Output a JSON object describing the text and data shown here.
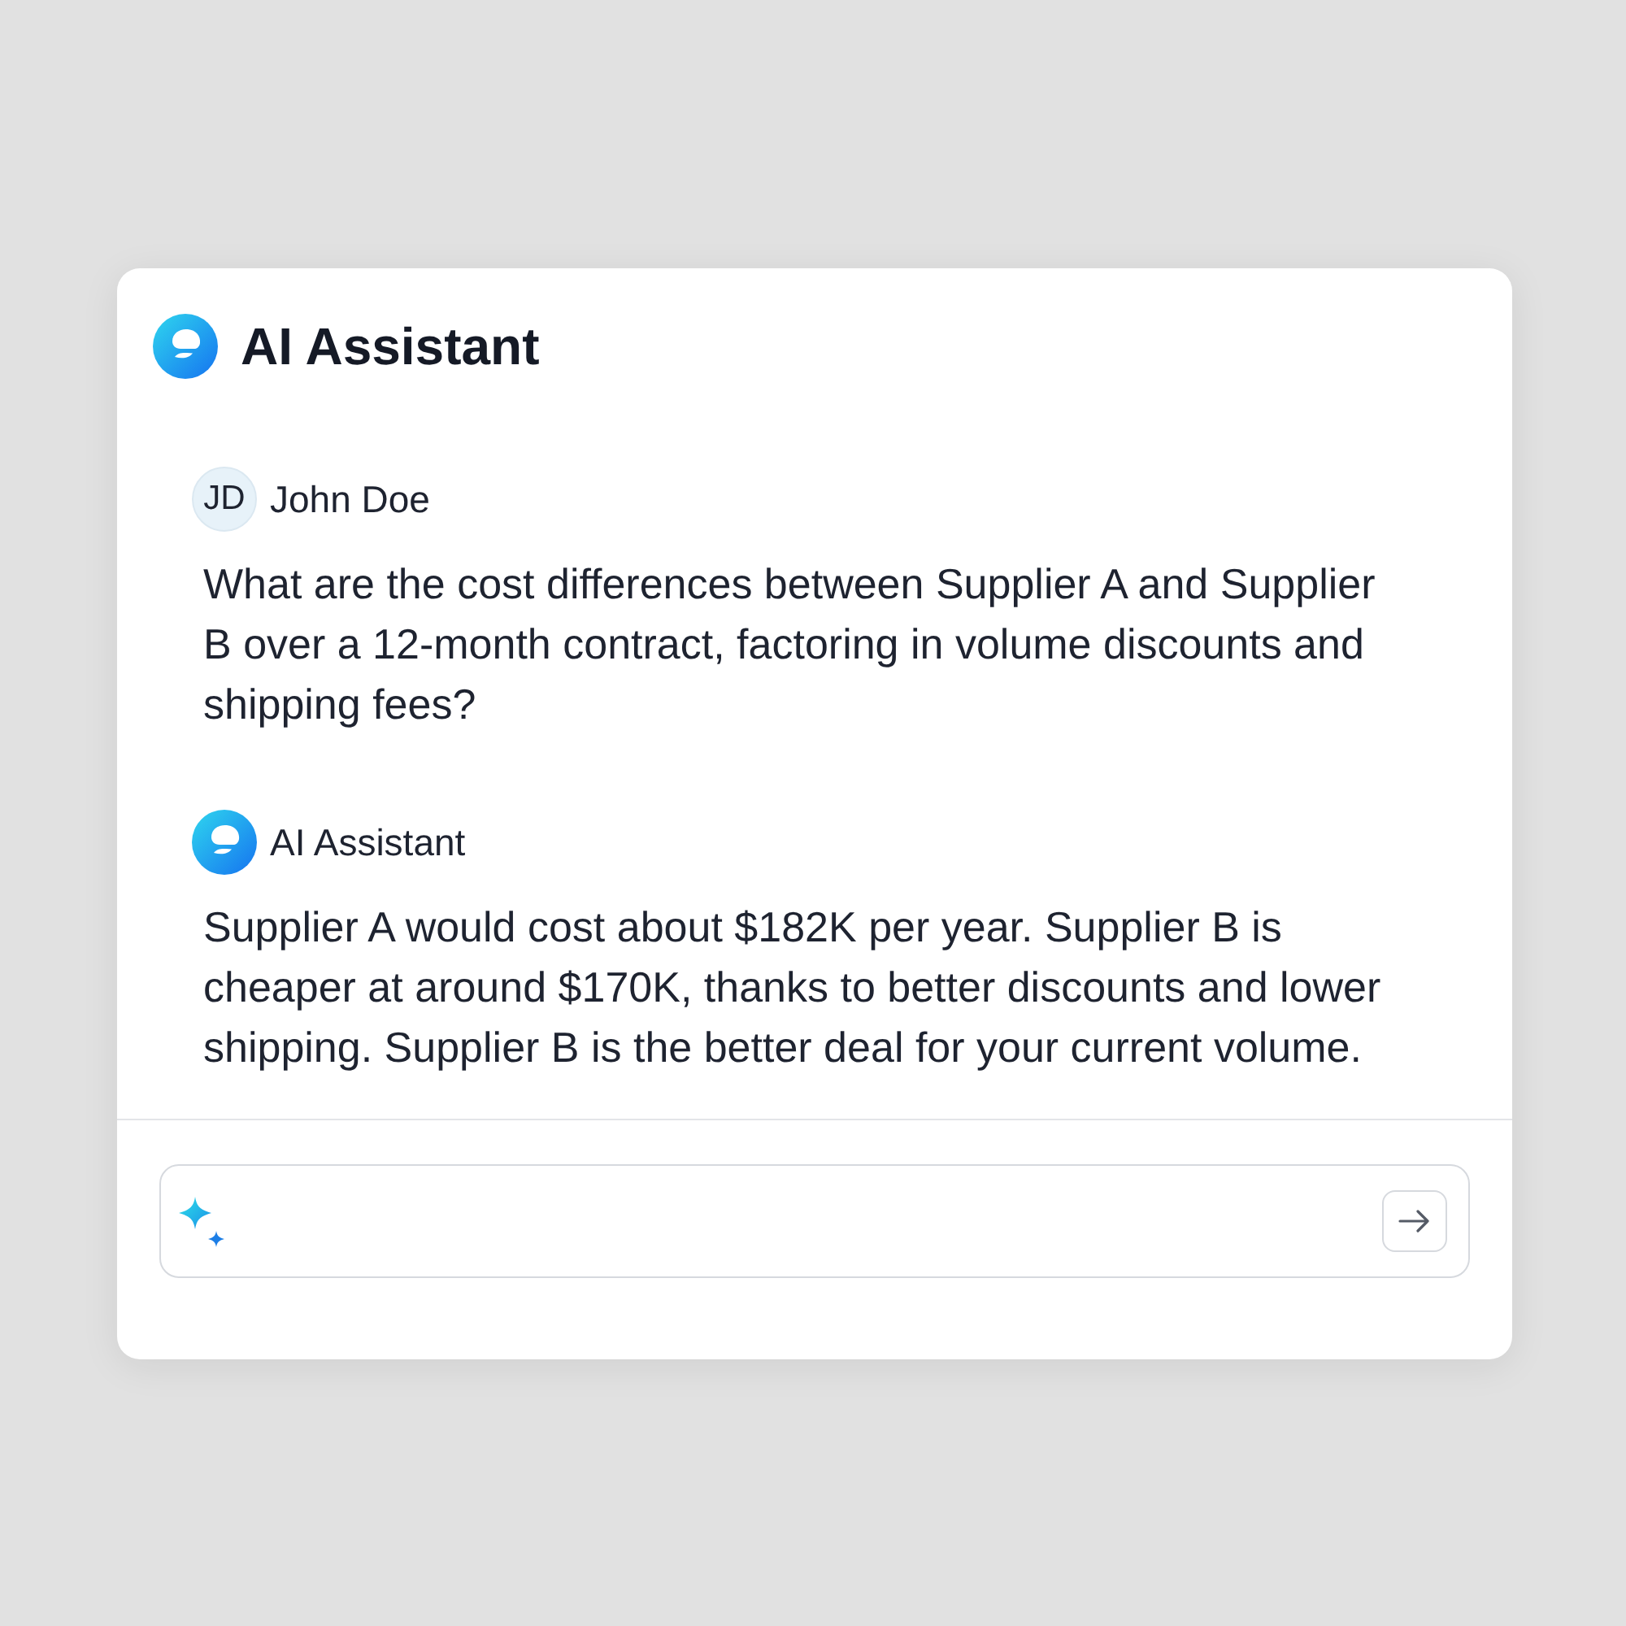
{
  "header": {
    "title": "AI Assistant"
  },
  "messages": [
    {
      "kind": "user",
      "sender": "John Doe",
      "initials": "JD",
      "text": "What are the cost differences between Supplier A and Supplier B over a 12-month contract, factoring in volume discounts and shipping fees?"
    },
    {
      "kind": "assistant",
      "sender": "AI Assistant",
      "text": "Supplier A would cost about $182K per year. Supplier B is cheaper at around $170K, thanks to better discounts and lower shipping. Supplier B is the better deal for your current volume."
    }
  ]
}
